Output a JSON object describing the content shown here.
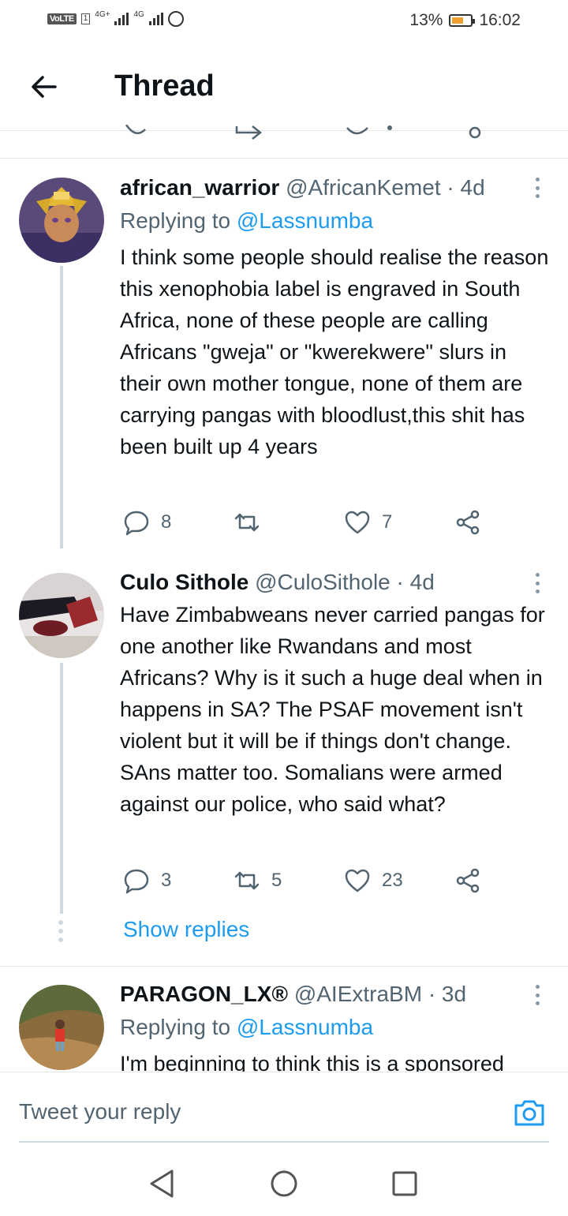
{
  "status_bar": {
    "volte": "VoLTE",
    "sim": "1",
    "net1": "4G+",
    "net2": "4G",
    "battery": "13%",
    "time": "16:02"
  },
  "header": {
    "title": "Thread"
  },
  "tweets": [
    {
      "name": "african_warrior",
      "handle": "@AfricanKemet",
      "time": "· 4d",
      "replying_label": "Replying to",
      "replying_handle": "@Lassnumba",
      "text": "I think some people should realise the reason this xenophobia label is engraved in South Africa, none of these people are calling Africans \"gweja\" or \"kwerekwere\" slurs in their own mother tongue, none of them are carrying pangas with bloodlust,this shit has been built up 4 years",
      "replies": "8",
      "retweets": "",
      "likes": "7"
    },
    {
      "name": "Culo Sithole",
      "handle": "@CuloSithole",
      "time": "· 4d",
      "text": "Have Zimbabweans never carried pangas for one another like Rwandans and most Africans? Why is it such a huge deal when in happens in SA? The PSAF movement isn't violent but it will be if things don't change. SAns matter too. Somalians were armed against our police, who said what?",
      "replies": "3",
      "retweets": "5",
      "likes": "23"
    },
    {
      "name": "PARAGON_LX®",
      "handle": "@AIExtraBM",
      "time": "· 3d",
      "replying_label": "Replying to",
      "replying_handle": "@Lassnumba",
      "text": "I'm beginning to think this is a sponsored"
    }
  ],
  "show_replies": "Show replies",
  "reply_bar": {
    "placeholder": "Tweet your reply"
  },
  "colors": {
    "accent": "#1d9bf0",
    "text": "#0f1419",
    "muted": "#536471"
  },
  "icons": [
    "back-arrow-icon",
    "more-icon",
    "reply-icon",
    "retweet-icon",
    "like-icon",
    "share-icon",
    "camera-icon",
    "nav-back-icon",
    "nav-home-icon",
    "nav-recent-icon"
  ]
}
